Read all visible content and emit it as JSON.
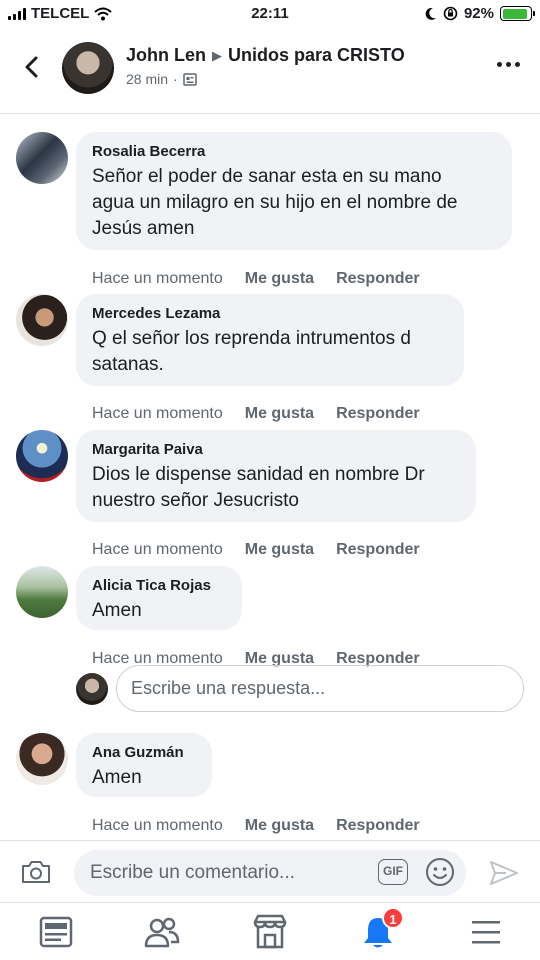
{
  "status_bar": {
    "carrier": "TELCEL",
    "time": "22:11",
    "battery_percent": "92%",
    "battery_level": 0.92
  },
  "header": {
    "author": "John Len",
    "group": "Unidos para CRISTO",
    "time": "28 min",
    "dot": "·"
  },
  "comments": [
    {
      "name": "Rosalia Becerra",
      "lines": [
        "Señor el poder de sanar  esta en su mano",
        "agua un milagro en su hijo en el nombre de",
        "Jesús amen"
      ],
      "time": "Hace un momento",
      "like": "Me gusta",
      "reply": "Responder"
    },
    {
      "name": "Mercedes Lezama",
      "lines": [
        "Q el señor los reprenda intrumentos d",
        "satanas."
      ],
      "time": "Hace un momento",
      "like": "Me gusta",
      "reply": "Responder"
    },
    {
      "name": "Margarita Paiva",
      "lines": [
        "Dios le dispense sanidad en nombre Dr",
        "nuestro señor Jesucristo"
      ],
      "time": "Hace un momento",
      "like": "Me gusta",
      "reply": "Responder"
    },
    {
      "name": "Alicia Tica Rojas",
      "lines": [
        "Amen"
      ],
      "time": "Hace un momento",
      "like": "Me gusta",
      "reply": "Responder"
    },
    {
      "name": "Ana Guzmán",
      "lines": [
        "Amen"
      ],
      "time": "Hace un momento",
      "like": "Me gusta",
      "reply": "Responder"
    }
  ],
  "reply_box": {
    "placeholder": "Escribe una respuesta..."
  },
  "composer": {
    "placeholder": "Escribe un comentario...",
    "gif_label": "GIF"
  },
  "bottom_nav": {
    "items": [
      "news-feed-icon",
      "groups-icon",
      "marketplace-icon",
      "notifications-icon",
      "menu-icon"
    ],
    "notifications_badge": "1"
  },
  "colors": {
    "facebook_blue": "#1877f2",
    "badge_red": "#fa3e3e",
    "bubble_gray": "#f0f2f5",
    "secondary_text": "#606770"
  }
}
